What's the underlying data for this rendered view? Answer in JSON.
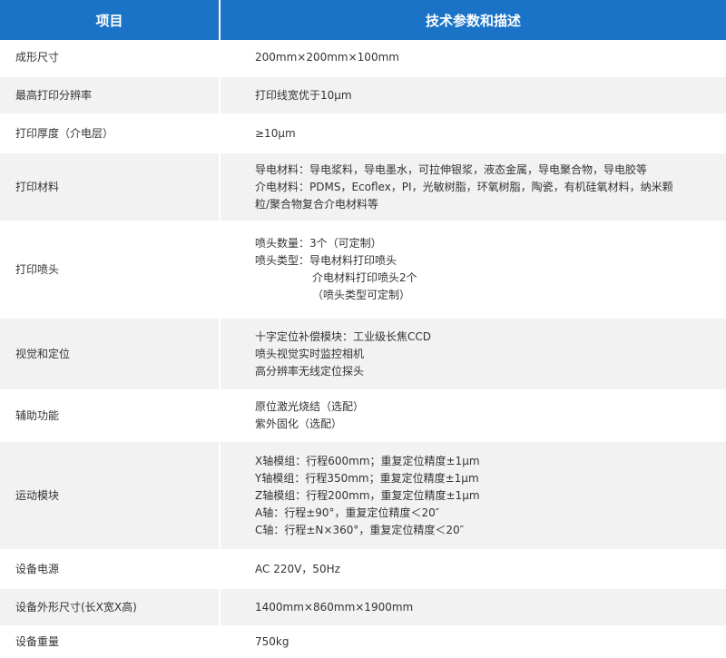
{
  "header": {
    "item": "项目",
    "spec": "技术参数和描述"
  },
  "rows": [
    {
      "item": "成形尺寸",
      "lines": [
        "200mm×200mm×100mm"
      ]
    },
    {
      "item": "最高打印分辨率",
      "lines": [
        "打印线宽优于10μm"
      ]
    },
    {
      "item": "打印厚度（介电层）",
      "lines": [
        "≥10μm"
      ]
    },
    {
      "item": "打印材料",
      "lines": [
        "导电材料：导电浆料，导电墨水，可拉伸银浆，液态金属，导电聚合物，导电胶等",
        "介电材料：PDMS，Ecoflex，PI，光敏树脂，环氧树脂，陶瓷，有机硅氧材料，纳米颗",
        "粒/聚合物复合介电材料等"
      ]
    },
    {
      "item": "打印喷头",
      "lines": [
        "喷头数量：3个（可定制）",
        "喷头类型：导电材料打印喷头",
        "介电材料打印喷头2个",
        "（喷头类型可定制）"
      ]
    },
    {
      "item": "视觉和定位",
      "lines": [
        "十字定位补偿模块：工业级长焦CCD",
        "喷头视觉实时监控相机",
        "高分辨率无线定位探头"
      ]
    },
    {
      "item": "辅助功能",
      "lines": [
        "原位激光烧结（选配）",
        "紫外固化（选配）"
      ]
    },
    {
      "item": "运动模块",
      "lines": [
        "X轴模组：行程600mm；重复定位精度±1μm",
        "Y轴模组：行程350mm；重复定位精度±1μm",
        "Z轴模组：行程200mm，重复定位精度±1μm",
        "A轴：行程±90°，重复定位精度＜20″",
        "C轴：行程±N×360°，重复定位精度＜20″"
      ]
    },
    {
      "item": "设备电源",
      "lines": [
        "AC 220V，50Hz"
      ]
    },
    {
      "item": "设备外形尺寸(长X宽X高)",
      "lines": [
        "1400mm×860mm×1900mm"
      ]
    },
    {
      "item": "设备重量",
      "lines": [
        "750kg"
      ]
    }
  ],
  "colors": {
    "header_bg": "#1a73c6",
    "header_text": "#ffffff",
    "stripe_bg": "#f2f2f2",
    "text": "#333333"
  }
}
